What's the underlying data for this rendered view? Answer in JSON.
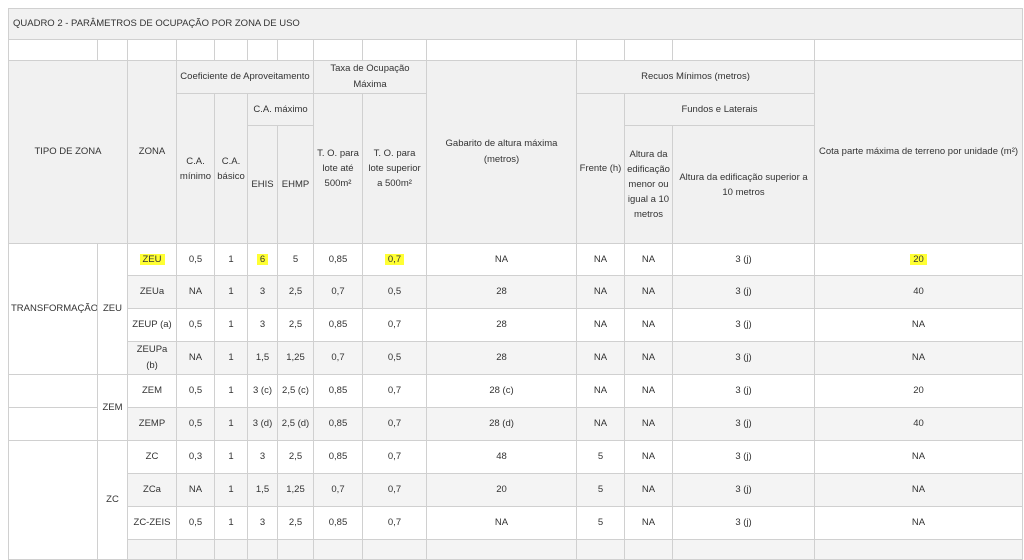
{
  "title": "QUADRO 2 - PARÂMETROS DE OCUPAÇÃO POR ZONA DE USO",
  "headers": {
    "tipo_de_zona": "TIPO DE ZONA",
    "zona": "ZONA",
    "coeficiente": "Coeficiente de Aproveitamento",
    "taxa": "Taxa de Ocupação Máxima",
    "gabarito": "Gabarito de altura máxima (metros)",
    "recuos": "Recuos Mínimos (metros)",
    "cota": "Cota parte máxima de terreno por unidade (m²)",
    "ca_maximo": "C.A. máximo",
    "fundos": "Fundos e Laterais",
    "ca_minimo": "C.A. mínimo",
    "ca_basico": "C.A. básico",
    "ehis": "EHIS",
    "ehmp": "EHMP",
    "to_ate": "T. O. para lote até 500m²",
    "to_superior": "T. O. para lote superior a 500m²",
    "frente": "Frente (h)",
    "altura_menor": "Altura da edificação menor ou igual a 10 metros",
    "altura_superior": "Altura da edificação superior a 10 metros"
  },
  "groups": {
    "transformacao": "TRANSFORMAÇÃO",
    "zeu": "ZEU",
    "zem": "ZEM",
    "zc": "ZC"
  },
  "rows": [
    [
      "ZEU",
      "0,5",
      "1",
      "6",
      "5",
      "0,85",
      "0,7",
      "NA",
      "NA",
      "NA",
      "3 (j)",
      "20"
    ],
    [
      "ZEUa",
      "NA",
      "1",
      "3",
      "2,5",
      "0,7",
      "0,5",
      "28",
      "NA",
      "NA",
      "3 (j)",
      "40"
    ],
    [
      "ZEUP (a)",
      "0,5",
      "1",
      "3",
      "2,5",
      "0,85",
      "0,7",
      "28",
      "NA",
      "NA",
      "3 (j)",
      "NA"
    ],
    [
      "ZEUPa (b)",
      "NA",
      "1",
      "1,5",
      "1,25",
      "0,7",
      "0,5",
      "28",
      "NA",
      "NA",
      "3 (j)",
      "NA"
    ],
    [
      "ZEM",
      "0,5",
      "1",
      "3 (c)",
      "2,5 (c)",
      "0,85",
      "0,7",
      "28 (c)",
      "NA",
      "NA",
      "3 (j)",
      "20"
    ],
    [
      "ZEMP",
      "0,5",
      "1",
      "3 (d)",
      "2,5 (d)",
      "0,85",
      "0,7",
      "28 (d)",
      "NA",
      "NA",
      "3 (j)",
      "40"
    ],
    [
      "ZC",
      "0,3",
      "1",
      "3",
      "2,5",
      "0,85",
      "0,7",
      "48",
      "5",
      "NA",
      "3 (j)",
      "NA"
    ],
    [
      "ZCa",
      "NA",
      "1",
      "1,5",
      "1,25",
      "0,7",
      "0,7",
      "20",
      "5",
      "NA",
      "3 (j)",
      "NA"
    ],
    [
      "ZC-ZEIS",
      "0,5",
      "1",
      "3",
      "2,5",
      "0,85",
      "0,7",
      "NA",
      "5",
      "NA",
      "3 (j)",
      "NA"
    ]
  ],
  "highlighted_cells": [
    "rows.0.0",
    "rows.0.3",
    "rows.0.6",
    "rows.0.11"
  ],
  "highlight_color": "#ffff33",
  "header_bg": "#f1f1f1",
  "stripe_bg": "#f4f4f4"
}
